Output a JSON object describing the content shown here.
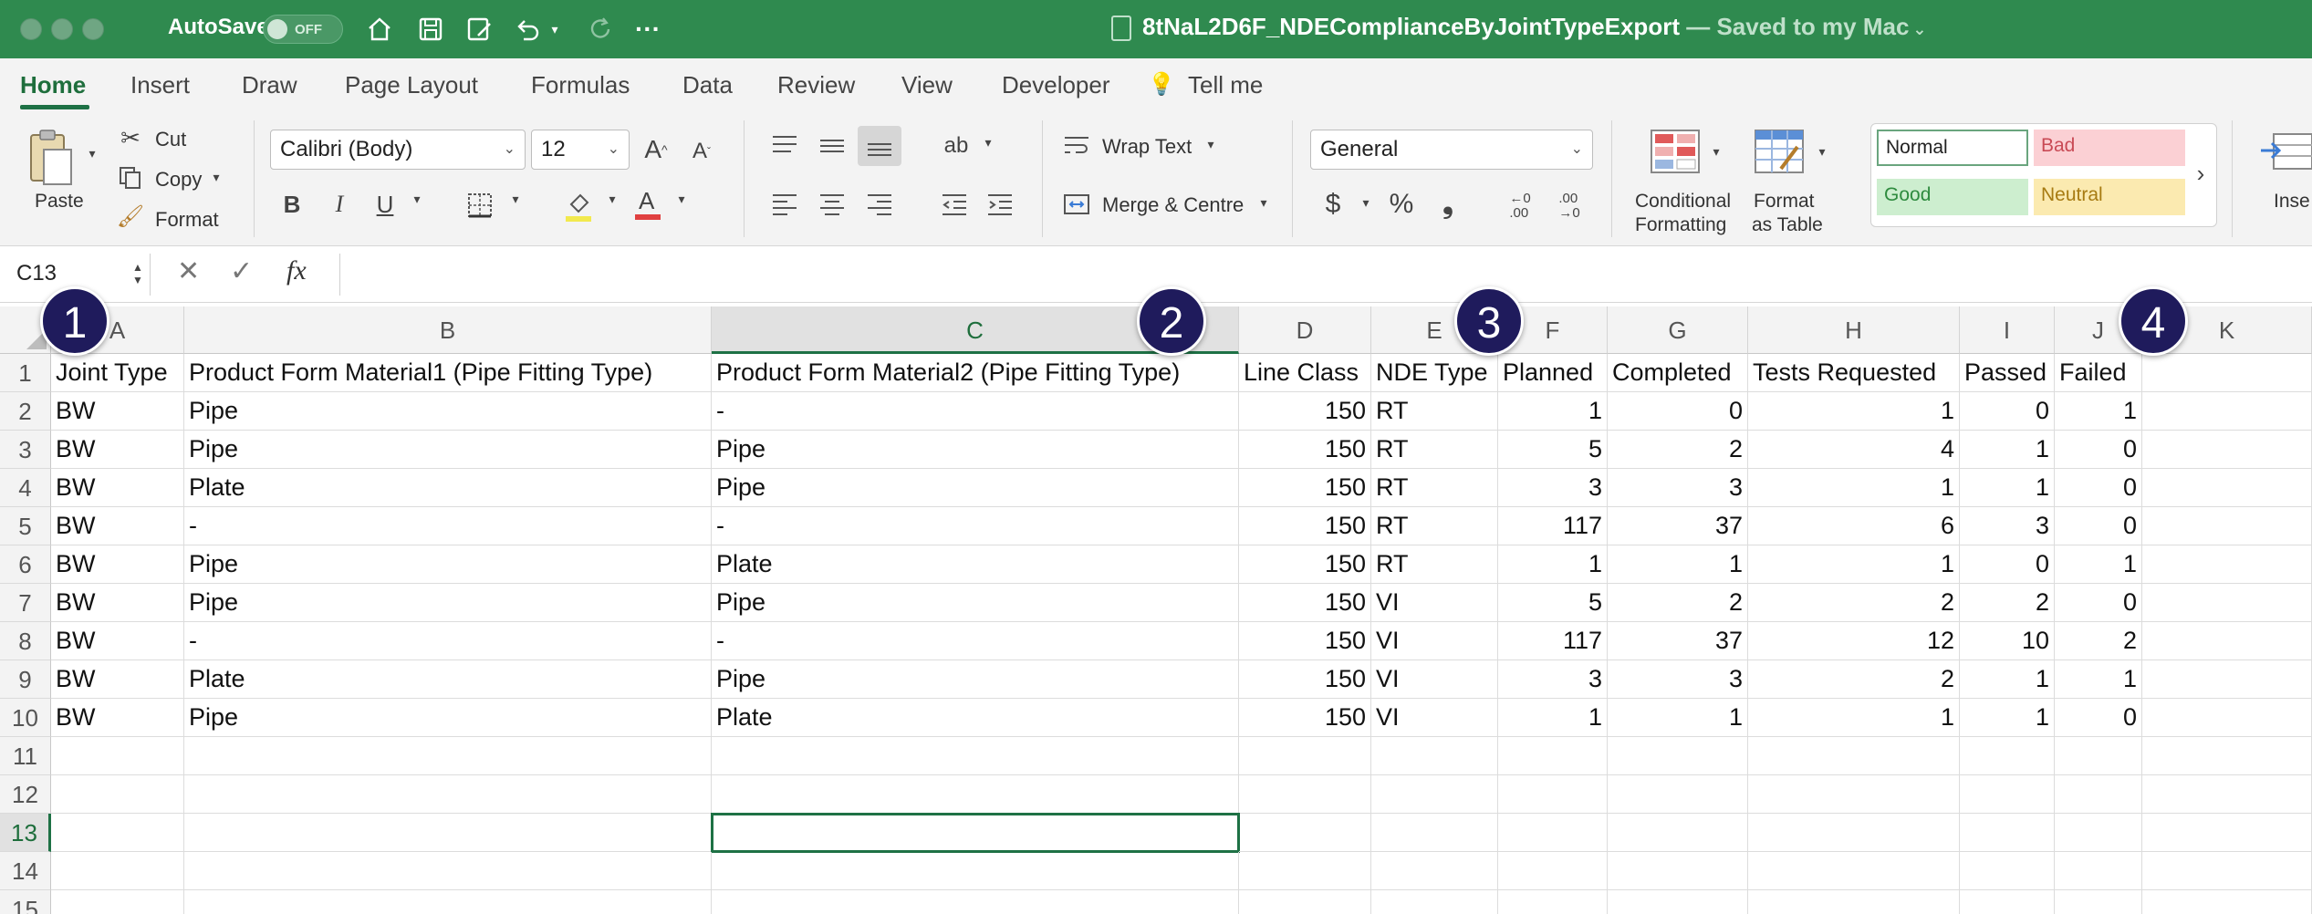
{
  "titlebar": {
    "autosave_label": "AutoSave",
    "autosave_state": "OFF",
    "file_name": "8tNaL2D6F_NDEComplianceByJointTypeExport",
    "saved_status": "— Saved to my Mac",
    "bg_color": "#2f8a4f"
  },
  "tabs": [
    "Home",
    "Insert",
    "Draw",
    "Page Layout",
    "Formulas",
    "Data",
    "Review",
    "View",
    "Developer"
  ],
  "tell_me": "Tell me",
  "ribbon": {
    "paste": "Paste",
    "cut": "Cut",
    "copy": "Copy",
    "format": "Format",
    "font_name": "Calibri (Body)",
    "font_size": "12",
    "bold": "B",
    "italic": "I",
    "underline": "U",
    "wrap_text": "Wrap Text",
    "merge_centre": "Merge & Centre",
    "number_format": "General",
    "currency": "$",
    "percent": "%",
    "comma": "❟",
    "conditional_formatting_1": "Conditional",
    "conditional_formatting_2": "Formatting",
    "format_as_table_1": "Format",
    "format_as_table_2": "as Table",
    "insert": "Inse",
    "styles": {
      "normal": "Normal",
      "bad": "Bad",
      "good": "Good",
      "neutral": "Neutral"
    }
  },
  "formula_bar": {
    "name_box": "C13",
    "fx": "fx",
    "formula": ""
  },
  "sheet": {
    "columns": [
      "A",
      "B",
      "C",
      "D",
      "E",
      "F",
      "G",
      "H",
      "I",
      "J",
      "K"
    ],
    "selected_column": "C",
    "selected_row": 13,
    "rows": [
      [
        "Joint Type",
        "Product Form Material1 (Pipe Fitting Type)",
        "Product Form Material2 (Pipe Fitting Type)",
        "Line Class",
        "NDE Type",
        "Planned",
        "Completed",
        "Tests Requested",
        "Passed",
        "Failed",
        ""
      ],
      [
        "BW",
        "Pipe",
        "-",
        "150",
        "RT",
        "1",
        "0",
        "1",
        "0",
        "1",
        ""
      ],
      [
        "BW",
        "Pipe",
        "Pipe",
        "150",
        "RT",
        "5",
        "2",
        "4",
        "1",
        "0",
        ""
      ],
      [
        "BW",
        "Plate",
        "Pipe",
        "150",
        "RT",
        "3",
        "3",
        "1",
        "1",
        "0",
        ""
      ],
      [
        "BW",
        "-",
        "-",
        "150",
        "RT",
        "117",
        "37",
        "6",
        "3",
        "0",
        ""
      ],
      [
        "BW",
        "Pipe",
        "Plate",
        "150",
        "RT",
        "1",
        "1",
        "1",
        "0",
        "1",
        ""
      ],
      [
        "BW",
        "Pipe",
        "Pipe",
        "150",
        "VI",
        "5",
        "2",
        "2",
        "2",
        "0",
        ""
      ],
      [
        "BW",
        "-",
        "-",
        "150",
        "VI",
        "117",
        "37",
        "12",
        "10",
        "2",
        ""
      ],
      [
        "BW",
        "Plate",
        "Pipe",
        "150",
        "VI",
        "3",
        "3",
        "2",
        "1",
        "1",
        ""
      ],
      [
        "BW",
        "Pipe",
        "Plate",
        "150",
        "VI",
        "1",
        "1",
        "1",
        "1",
        "0",
        ""
      ],
      [
        "",
        "",
        "",
        "",
        "",
        "",
        "",
        "",
        "",
        "",
        ""
      ],
      [
        "",
        "",
        "",
        "",
        "",
        "",
        "",
        "",
        "",
        "",
        ""
      ],
      [
        "",
        "",
        "",
        "",
        "",
        "",
        "",
        "",
        "",
        "",
        ""
      ],
      [
        "",
        "",
        "",
        "",
        "",
        "",
        "",
        "",
        "",
        "",
        ""
      ],
      [
        "",
        "",
        "",
        "",
        "",
        "",
        "",
        "",
        "",
        "",
        ""
      ]
    ],
    "numeric_columns": [
      3,
      5,
      6,
      7,
      8,
      9
    ]
  },
  "callouts": [
    "1",
    "2",
    "3",
    "4"
  ]
}
